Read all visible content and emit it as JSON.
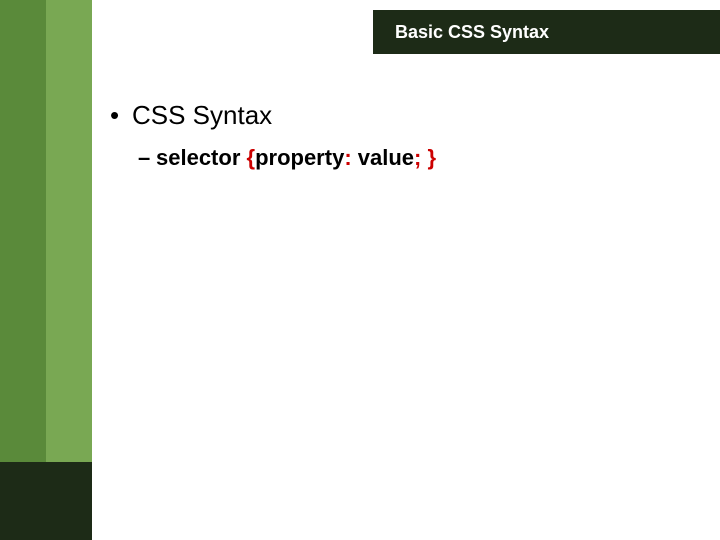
{
  "header": {
    "title": "Basic CSS Syntax"
  },
  "body": {
    "bullet_label": "CSS Syntax",
    "subbullet": {
      "dash": "–",
      "parts": {
        "selector": "selector ",
        "brace_open": "{",
        "property": "property",
        "colon": ": ",
        "value": "value",
        "semicolon": "; ",
        "brace_close": "}"
      }
    }
  },
  "glyphs": {
    "bullet": "•"
  }
}
